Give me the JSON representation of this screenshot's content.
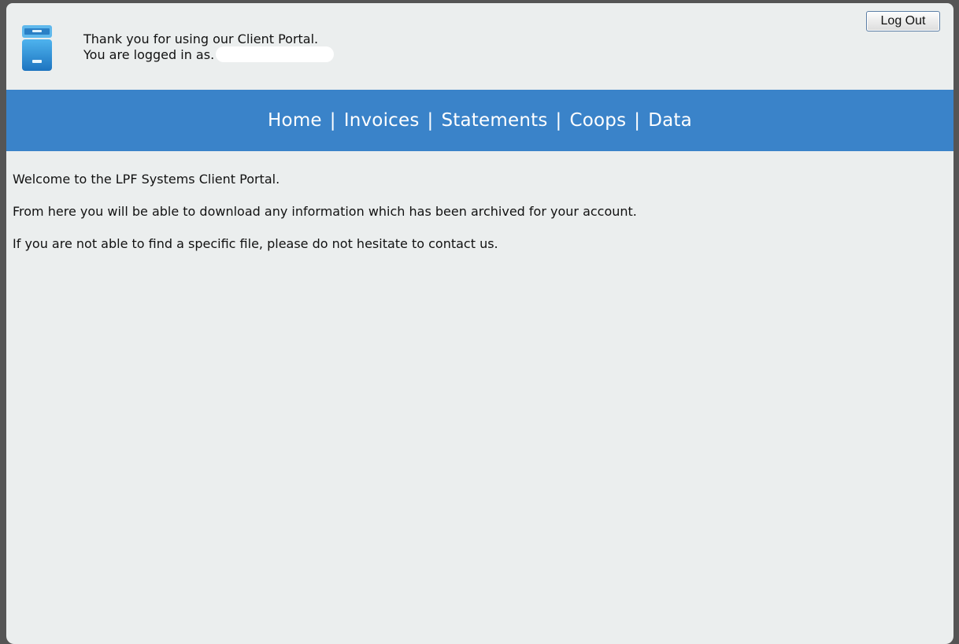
{
  "header": {
    "welcome_line1": "Thank you for using our Client Portal.",
    "welcome_line2": "You are logged in as.",
    "logout_label": "Log Out"
  },
  "nav": {
    "items": [
      {
        "label": "Home"
      },
      {
        "label": "Invoices"
      },
      {
        "label": "Statements"
      },
      {
        "label": "Coops"
      },
      {
        "label": "Data"
      }
    ],
    "separator": "|"
  },
  "content": {
    "paragraphs": [
      "Welcome to the LPF Systems Client Portal.",
      "From here you will be able to download any information which has been archived for your account.",
      "If you are not able to find a specific file, please do not hesitate to contact us."
    ]
  },
  "icons": {
    "logo": "file-cabinet-icon"
  },
  "colors": {
    "nav_bar": "#3a83c9",
    "page_background": "#ebeeee",
    "outer_background": "#555555"
  }
}
